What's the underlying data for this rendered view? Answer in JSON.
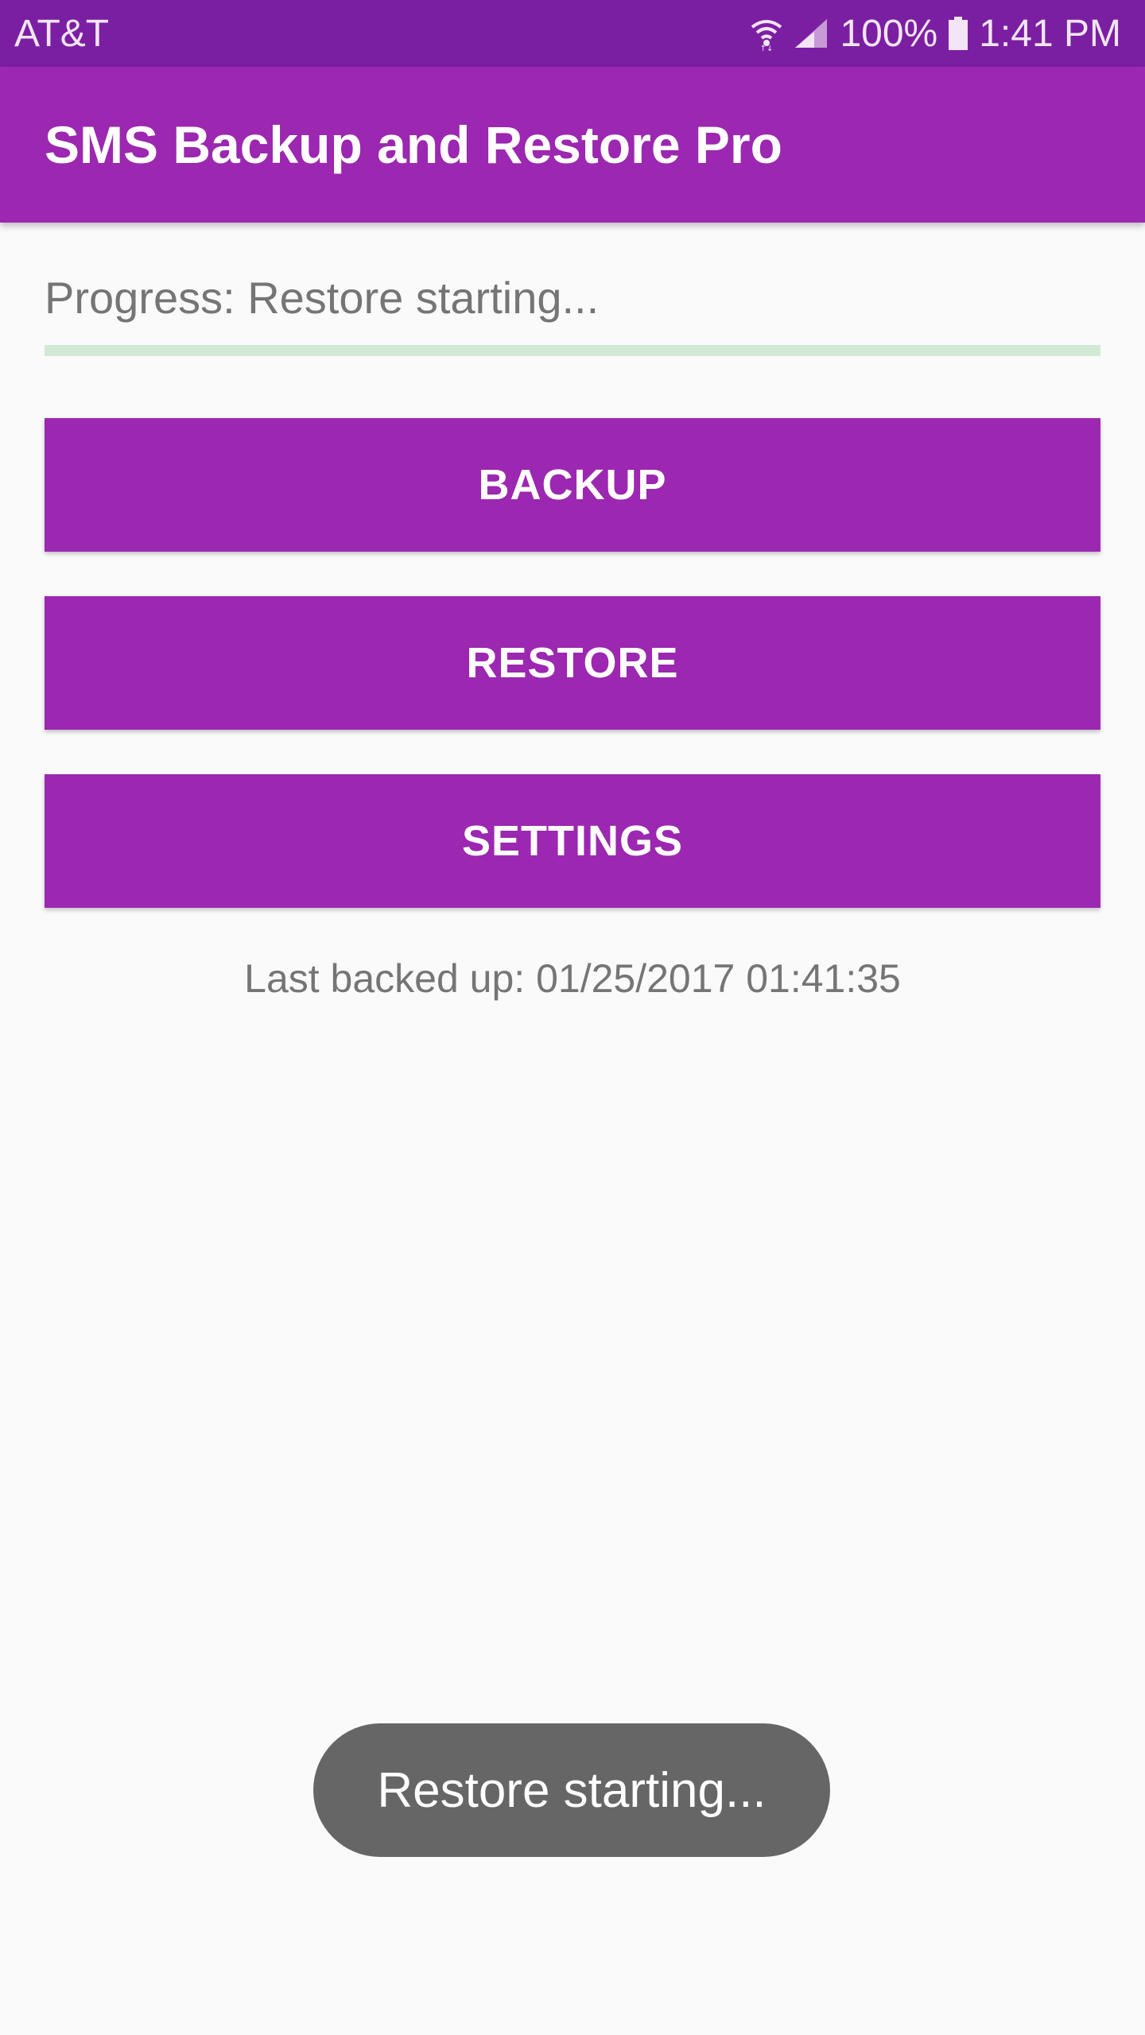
{
  "status_bar": {
    "carrier": "AT&T",
    "battery": "100%",
    "time": "1:41 PM",
    "icons": [
      "wifi-icon",
      "signal-icon",
      "battery-icon"
    ]
  },
  "app_bar": {
    "title": "SMS Backup and Restore Pro"
  },
  "progress": {
    "label": "Progress: Restore starting...",
    "fraction": 0
  },
  "buttons": {
    "backup": "BACKUP",
    "restore": "RESTORE",
    "settings": "SETTINGS"
  },
  "last_backed_up": "Last backed up: 01/25/2017 01:41:35",
  "toast": "Restore starting...",
  "colors": {
    "status_bar": "#7b1fa2",
    "app_bar": "#9c27b0",
    "button": "#9c27b0",
    "progress_track": "#d2ead3",
    "toast": "#666666"
  }
}
